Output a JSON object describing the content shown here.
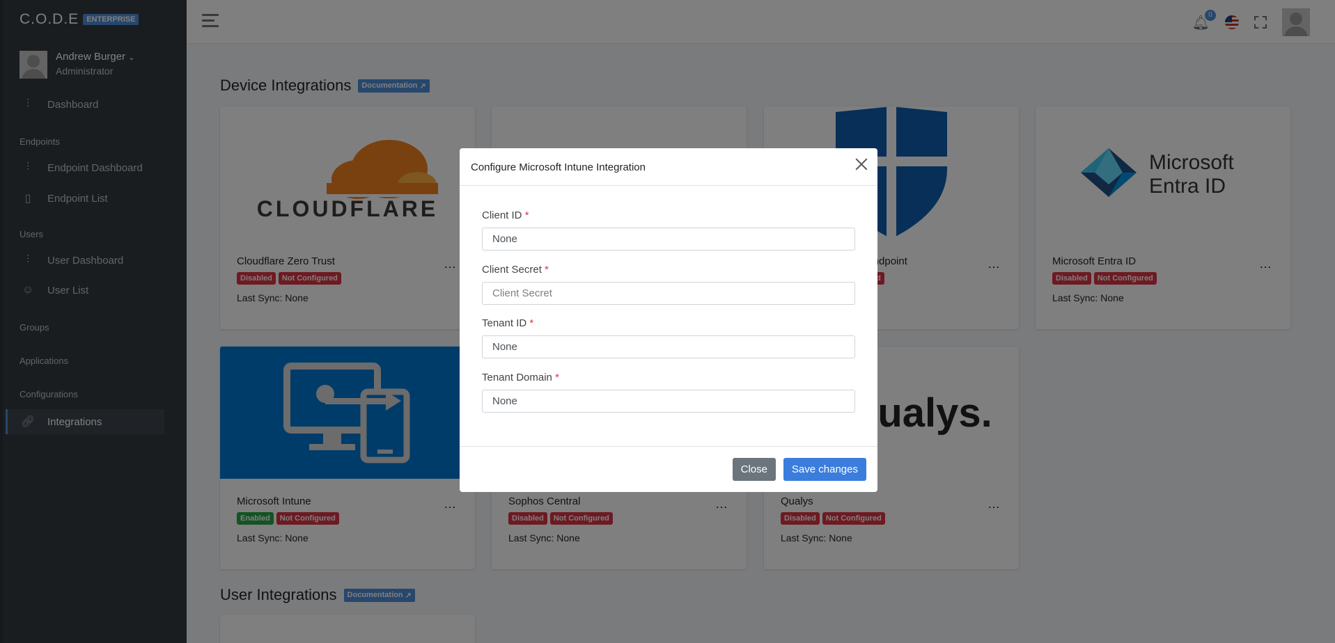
{
  "brand": {
    "name": "C.O.D.E",
    "badge": "ENTERPRISE"
  },
  "user": {
    "name": "Andrew Burger",
    "role": "Administrator"
  },
  "sidebar": {
    "dashboard": "Dashboard",
    "headers": {
      "endpoints": "Endpoints",
      "users": "Users",
      "groups": "Groups",
      "applications": "Applications",
      "configurations": "Configurations"
    },
    "endpoint_dashboard": "Endpoint Dashboard",
    "endpoint_list": "Endpoint List",
    "user_dashboard": "User Dashboard",
    "user_list": "User List",
    "integrations": "Integrations"
  },
  "topbar": {
    "notification_count": "0"
  },
  "sections": {
    "device_integrations": "Device Integrations",
    "user_integrations": "User Integrations",
    "documentation": "Documentation"
  },
  "cards": [
    {
      "title": "Cloudflare Zero Trust",
      "status": "Disabled",
      "config": "Not Configured",
      "sync": "Last Sync: None"
    },
    {
      "title": "",
      "status": "",
      "config": "",
      "sync": ""
    },
    {
      "title": "for Endpoint",
      "status": "",
      "config": "ed",
      "sync": ""
    },
    {
      "title": "Microsoft Entra ID",
      "status": "Disabled",
      "config": "Not Configured",
      "sync": "Last Sync: None"
    },
    {
      "title": "Microsoft Intune",
      "status": "Enabled",
      "config": "Not Configured",
      "sync": "Last Sync: None"
    },
    {
      "title": "Sophos Central",
      "status": "Disabled",
      "config": "Not Configured",
      "sync": "Last Sync: None"
    },
    {
      "title": "Qualys",
      "status": "Disabled",
      "config": "Not Configured",
      "sync": "Last Sync: None"
    }
  ],
  "logos": {
    "cloudflare": "CLOUDFLARE",
    "entra_line1": "Microsoft",
    "entra_line2": "Entra ID",
    "qualys": "Qualys."
  },
  "colors": {
    "accent": "#3b7ddd",
    "danger": "#dc3545",
    "success": "#28a745",
    "sidebar": "#343a40"
  },
  "modal": {
    "title": "Configure Microsoft Intune Integration",
    "fields": [
      {
        "label": "Client ID",
        "required": "*",
        "value": "None",
        "placeholder": ""
      },
      {
        "label": "Client Secret",
        "required": "*",
        "value": "",
        "placeholder": "Client Secret"
      },
      {
        "label": "Tenant ID",
        "required": "*",
        "value": "None",
        "placeholder": ""
      },
      {
        "label": "Tenant Domain",
        "required": "*",
        "value": "None",
        "placeholder": ""
      }
    ],
    "close_label": "Close",
    "save_label": "Save changes"
  }
}
